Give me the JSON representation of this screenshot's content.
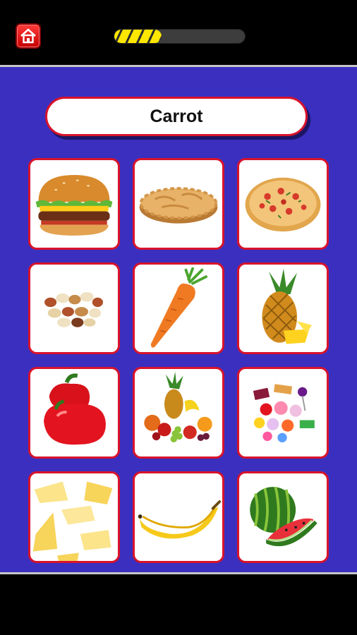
{
  "header": {
    "home_icon": "home-icon",
    "progress_fraction": 0.36
  },
  "prompt": {
    "word": "Carrot"
  },
  "tiles": [
    {
      "item": "burger",
      "icon": "burger-image"
    },
    {
      "item": "pie",
      "icon": "pie-image"
    },
    {
      "item": "pizza",
      "icon": "pizza-image"
    },
    {
      "item": "nuts",
      "icon": "nuts-image"
    },
    {
      "item": "carrot",
      "icon": "carrot-image"
    },
    {
      "item": "pineapple",
      "icon": "pineapple-image"
    },
    {
      "item": "pepper",
      "icon": "pepper-image"
    },
    {
      "item": "fruits",
      "icon": "fruits-image"
    },
    {
      "item": "candy",
      "icon": "candy-image"
    },
    {
      "item": "cheese",
      "icon": "cheese-image"
    },
    {
      "item": "banana",
      "icon": "banana-image"
    },
    {
      "item": "watermelon",
      "icon": "watermelon-image"
    }
  ],
  "colors": {
    "board": "#3a2fbf",
    "tile_border": "#d8132b",
    "progress_fill": "#ffe600"
  }
}
